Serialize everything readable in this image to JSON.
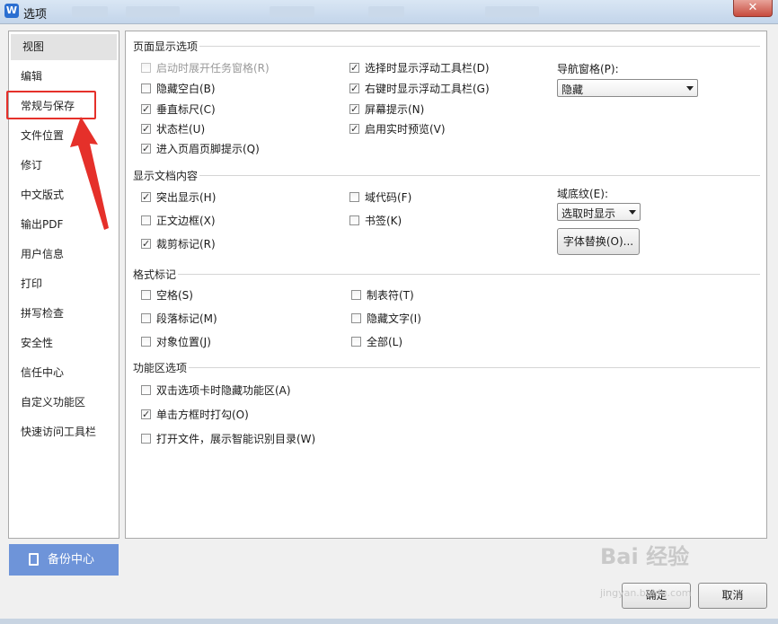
{
  "window": {
    "title": "选项",
    "app_icon": "W",
    "close_label": "✕"
  },
  "nav": {
    "items": [
      {
        "label": "视图",
        "selected": true
      },
      {
        "label": "编辑"
      },
      {
        "label": "常规与保存"
      },
      {
        "label": "文件位置"
      },
      {
        "label": "修订"
      },
      {
        "label": "中文版式"
      },
      {
        "label": "输出PDF"
      },
      {
        "label": "用户信息"
      },
      {
        "label": "打印"
      },
      {
        "label": "拼写检查"
      },
      {
        "label": "安全性"
      },
      {
        "label": "信任中心"
      },
      {
        "label": "自定义功能区"
      },
      {
        "label": "快速访问工具栏"
      }
    ],
    "backup_label": "备份中心"
  },
  "page_display": {
    "title": "页面显示选项",
    "col1": [
      {
        "label": "启动时展开任务窗格(R)",
        "checked": false,
        "disabled": true
      },
      {
        "label": "隐藏空白(B)",
        "checked": false
      },
      {
        "label": "垂直标尺(C)",
        "checked": true
      },
      {
        "label": "状态栏(U)",
        "checked": true
      },
      {
        "label": "进入页眉页脚提示(Q)",
        "checked": true
      }
    ],
    "col2": [
      {
        "label": "选择时显示浮动工具栏(D)",
        "checked": true
      },
      {
        "label": "右键时显示浮动工具栏(G)",
        "checked": true
      },
      {
        "label": "屏幕提示(N)",
        "checked": true
      },
      {
        "label": "启用实时预览(V)",
        "checked": true
      }
    ],
    "nav_pane_label": "导航窗格(P):",
    "nav_pane_value": "隐藏"
  },
  "doc_content": {
    "title": "显示文档内容",
    "col1": [
      {
        "label": "突出显示(H)",
        "checked": true
      },
      {
        "label": "正文边框(X)",
        "checked": false
      },
      {
        "label": "裁剪标记(R)",
        "checked": true
      }
    ],
    "col2": [
      {
        "label": "域代码(F)",
        "checked": false
      },
      {
        "label": "书签(K)",
        "checked": false
      }
    ],
    "field_shading_label": "域底纹(E):",
    "field_shading_value": "选取时显示",
    "font_replace_label": "字体替换(O)..."
  },
  "format_marks": {
    "title": "格式标记",
    "col1": [
      {
        "label": "空格(S)",
        "checked": false
      },
      {
        "label": "段落标记(M)",
        "checked": false
      },
      {
        "label": "对象位置(J)",
        "checked": false
      }
    ],
    "col2": [
      {
        "label": "制表符(T)",
        "checked": false
      },
      {
        "label": "隐藏文字(I)",
        "checked": false
      },
      {
        "label": "全部(L)",
        "checked": false
      }
    ]
  },
  "ribbon": {
    "title": "功能区选项",
    "items": [
      {
        "label": "双击选项卡时隐藏功能区(A)",
        "checked": false
      },
      {
        "label": "单击方框时打勾(O)",
        "checked": true
      },
      {
        "label": "打开文件，展示智能识别目录(W)",
        "checked": false
      }
    ]
  },
  "footer": {
    "ok_label": "确定",
    "cancel_label": "取消"
  },
  "watermark": {
    "brand": "Bai 经验",
    "url": "jingyan.baidu.com"
  },
  "colors": {
    "accent": "#6e94d9",
    "highlight": "#e5302a",
    "selected_nav": "#e3e3e3"
  }
}
